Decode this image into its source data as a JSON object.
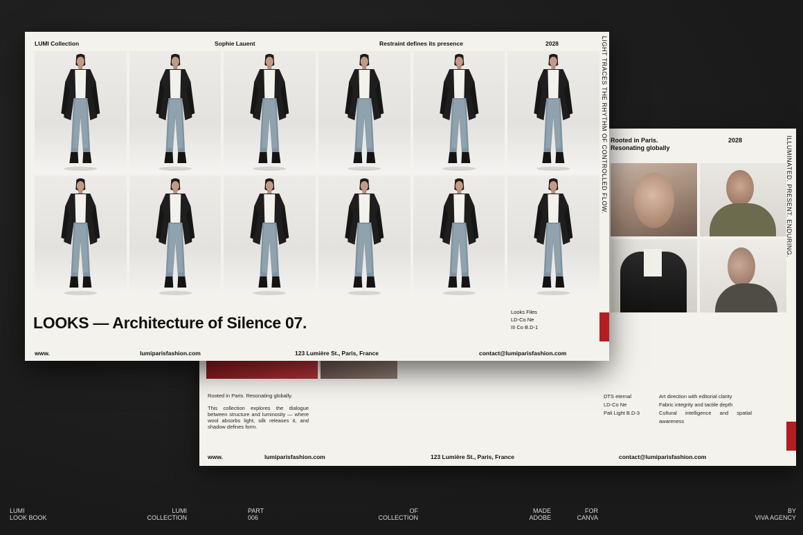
{
  "front": {
    "header": {
      "collection": "LUMI Collection",
      "designer": "Sophie Lauent",
      "tagline": "Restraint defines its presence",
      "year": "2028"
    },
    "vertical_text": "LIGHT TRACES THE RHYTHM OF CONTROLLED FLOW.",
    "looks_count": 12,
    "title": "LOOKS — Architecture of Silence 07.",
    "files": {
      "heading": "Looks Files",
      "line1": "LD-Co Ne",
      "line2": "III Co B.D-1"
    },
    "footer": {
      "www": "www.",
      "site": "lumiparisfashion.com",
      "address": "123 Lumière St., Paris, France",
      "email": "contact@lumiparisfashion.com"
    },
    "accent": "#b41d22"
  },
  "back": {
    "header": {
      "tagline": "Rooted in Paris. Resonating globally",
      "year": "2028"
    },
    "vertical_text": "ILLUMINATED. PRESENT. ENDURING.",
    "intro_heading": "Rooted in Paris. Resonating globally.",
    "intro_body": "This collection explores the dialogue between structure and luminosity — where wool absorbs light, silk releases it, and shadow defines form.",
    "specs": [
      "DTS eternal",
      "LD-Co Ne",
      "Pali Light B.D-3"
    ],
    "notes": [
      "Art direction with editorial clarity",
      "Fabric integrity and tactile depth",
      "Cultural intelligence and spatial awareness"
    ],
    "footer": {
      "www": "www.",
      "site": "lumiparisfashion.com",
      "address": "123 Lumière St., Paris, France",
      "email": "contact@lumiparisfashion.com"
    }
  },
  "captions": {
    "c1": "LUMI",
    "c1b": "LOOK BOOK",
    "c2": "LUMI",
    "c2b": "COLLECTION",
    "c3": "PART",
    "c3b": "006",
    "c4": "OF",
    "c4b": "COLLECTION",
    "c5": "MADE",
    "c5b": "ADOBE",
    "c6": "FOR",
    "c6b": "CANVA",
    "c7": "BY",
    "c7b": "VIVA AGENCY"
  }
}
